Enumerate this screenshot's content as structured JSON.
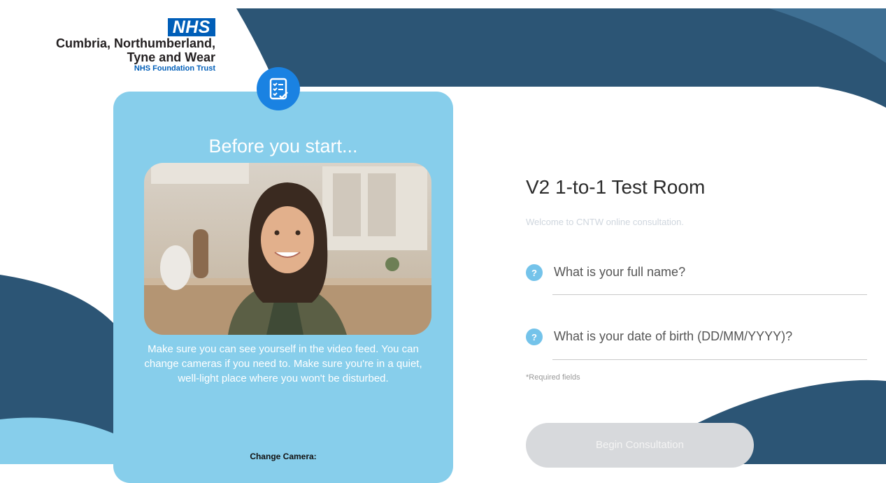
{
  "colors": {
    "navy": "#2c5575",
    "sky": "#87CEEB",
    "nhs_blue": "#005EB8",
    "badge_blue": "#1a82e2"
  },
  "logo": {
    "mark": "NHS",
    "org_line1": "Cumbria, Northumberland,",
    "org_line2": "Tyne and Wear",
    "trust": "NHS Foundation Trust"
  },
  "panel": {
    "badge_icon": "checklist-icon",
    "title": "Before you start...",
    "photo_description_icon": "camera-preview",
    "instructions": "Make sure you can see yourself in the video feed. You can change cameras if you need to. Make sure you're in a quiet, well-light place where you won't be disturbed.",
    "change_camera": "Change Camera:"
  },
  "form": {
    "title": "V2 1-to-1 Test Room",
    "welcome": "Welcome to CNTW online consultation.",
    "fields": [
      {
        "help": "?",
        "label": "What is your full name?"
      },
      {
        "help": "?",
        "label": "What is your date of birth (DD/MM/YYYY)?"
      }
    ],
    "required_note": "*Required fields",
    "submit": "Begin Consultation"
  }
}
